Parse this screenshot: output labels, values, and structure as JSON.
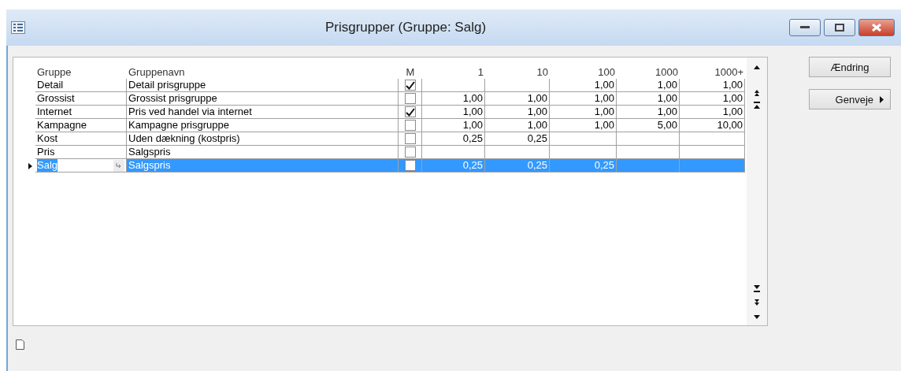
{
  "window": {
    "title": "Prisgrupper (Gruppe: Salg)"
  },
  "table": {
    "columns": [
      "Gruppe",
      "Gruppenavn",
      "M",
      "1",
      "10",
      "100",
      "1000",
      "1000+"
    ],
    "rows": [
      {
        "gruppe": "Detail",
        "navn": "Detail prisgruppe",
        "m": true,
        "prices": {
          "q100": "1,00",
          "q1000": "1,00",
          "q1000plus": "1,00"
        },
        "selected": false
      },
      {
        "gruppe": "Grossist",
        "navn": "Grossist prisgruppe",
        "m": false,
        "prices": {
          "q1": "1,00",
          "q10": "1,00",
          "q100": "1,00",
          "q1000": "1,00",
          "q1000plus": "1,00"
        },
        "selected": false
      },
      {
        "gruppe": "Internet",
        "navn": "Pris ved handel via internet",
        "m": true,
        "prices": {
          "q1": "1,00",
          "q10": "1,00",
          "q100": "1,00",
          "q1000": "1,00",
          "q1000plus": "1,00"
        },
        "selected": false
      },
      {
        "gruppe": "Kampagne",
        "navn": "Kampagne prisgruppe",
        "m": false,
        "prices": {
          "q1": "1,00",
          "q10": "1,00",
          "q100": "1,00",
          "q1000": "5,00",
          "q1000plus": "10,00"
        },
        "selected": false
      },
      {
        "gruppe": "Kost",
        "navn": "Uden dækning (kostpris)",
        "m": false,
        "prices": {
          "q1": "0,25",
          "q10": "0,25"
        },
        "selected": false
      },
      {
        "gruppe": "Pris",
        "navn": "Salgspris",
        "m": false,
        "selected": false
      },
      {
        "gruppe": "Salg",
        "navn": "Salgspris",
        "m": false,
        "prices": {
          "q1": "0,25",
          "q10": "0,25",
          "q100": "0,25"
        },
        "selected": true
      }
    ]
  },
  "buttons": [
    {
      "label": "Ændring",
      "kind": "plain"
    },
    {
      "label": "Genveje",
      "kind": "menu"
    }
  ]
}
